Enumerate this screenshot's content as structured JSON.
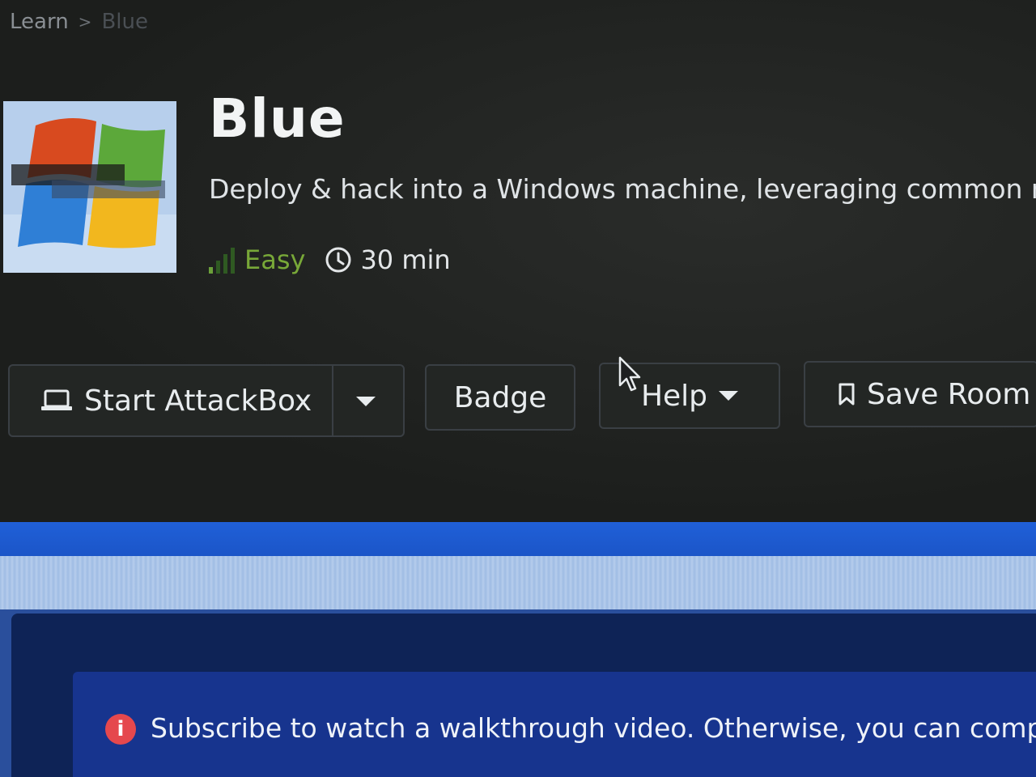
{
  "breadcrumb": {
    "items": [
      "Learn",
      "Blue"
    ],
    "separator": ">"
  },
  "room": {
    "title": "Blue",
    "description": "Deploy & hack into a Windows machine, leveraging common misc",
    "difficulty": "Easy",
    "difficulty_level": 1,
    "difficulty_max": 4,
    "duration": "30 min",
    "logo_icon": "windows-logo"
  },
  "actions": {
    "start_attackbox": "Start AttackBox",
    "badge": "Badge",
    "help": "Help",
    "save_room": "Save Room"
  },
  "notice": {
    "text": "Subscribe to watch a walkthrough video. Otherwise, you can complete",
    "icon": "info-icon"
  },
  "colors": {
    "difficulty_easy": "#6ba03a",
    "notice_icon": "#e5484d",
    "blue_band": "#1b55c8"
  }
}
